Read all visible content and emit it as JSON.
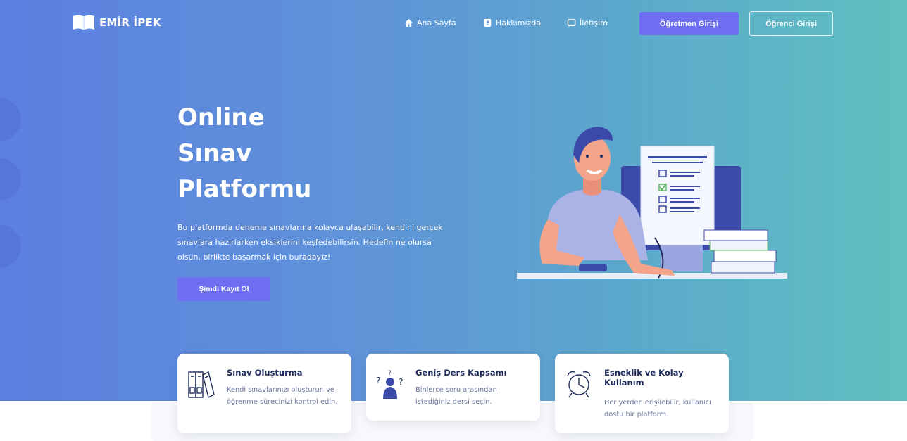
{
  "logo": {
    "text": "EMİR İPEK"
  },
  "nav": {
    "home": "Ana Sayfa",
    "about": "Hakkımızda",
    "contact": "İletişim",
    "teacher_login": "Öğretmen Girişi",
    "student_login": "Öğrenci Girişi"
  },
  "hero": {
    "title_lines": [
      "Online",
      "Sınav",
      "Platformu"
    ],
    "description": "Bu platformda deneme sınavlarına kolayca ulaşabilir, kendini gerçek sınavlara hazırlarken eksiklerini keşfedebilirsin. Hedefin ne olursa olsun, birlikte başarmak için buradayız!",
    "cta": "Şimdi Kayıt Ol"
  },
  "features": [
    {
      "title": "Sınav Oluşturma",
      "text": "Kendi sınavlarınızı oluşturun ve öğrenme sürecinizi kontrol edin.",
      "icon": "books-icon"
    },
    {
      "title": "Geniş Ders Kapsamı",
      "text": "Binlerce soru arasından istediğiniz dersi seçin.",
      "icon": "question-person-icon"
    },
    {
      "title": "Esneklik ve Kolay Kullanım",
      "text": "Her yerden erişilebilir, kullanıcı dostu bir platform.",
      "icon": "alarm-clock-icon"
    }
  ],
  "colors": {
    "primary": "#6d6ef0",
    "gradient_start": "#5c7fe0",
    "gradient_end": "#60c0c0",
    "title_dark": "#1e2b5a"
  }
}
